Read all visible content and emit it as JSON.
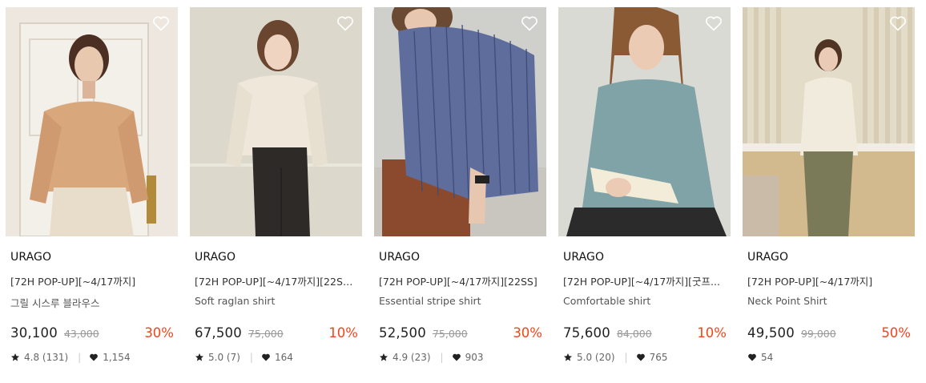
{
  "products": [
    {
      "brand": "URAGO",
      "title_line1": "[72H POP-UP][~4/17까지]",
      "title_line2": "그릴 시스루 블라우스",
      "price": "30,100",
      "original_price": "43,000",
      "discount": "30%",
      "rating": "4.8 (131)",
      "likes": "1,154",
      "image_description": "woman in sheer camel blouse and cream jeans, white door background",
      "colors": {
        "bg": "#e6dfd6",
        "top": "#d9a77c",
        "bottom": "#e8dccb",
        "hair": "#4a2f22"
      }
    },
    {
      "brand": "URAGO",
      "title_line1": "[72H POP-UP][~4/17까지][22SP...",
      "title_line2": "Soft raglan shirt",
      "price": "67,500",
      "original_price": "75,000",
      "discount": "10%",
      "rating": "5.0 (7)",
      "likes": "164",
      "image_description": "woman in ivory shirt and black trousers, beige wall",
      "colors": {
        "bg": "#dcd8cc",
        "top": "#efe8da",
        "bottom": "#2e2a28",
        "hair": "#6a4630"
      }
    },
    {
      "brand": "URAGO",
      "title_line1": "[72H POP-UP][~4/17까지][22SS]",
      "title_line2": "Essential stripe shirt",
      "price": "52,500",
      "original_price": "75,000",
      "discount": "30%",
      "rating": "4.9 (23)",
      "likes": "903",
      "image_description": "woman in blue stripe shirt leaning on wooden table",
      "colors": {
        "bg": "#cfcfcb",
        "top": "#5e6d9c",
        "bottom": "#8b4a2e",
        "hair": "#6b4a33"
      }
    },
    {
      "brand": "URAGO",
      "title_line1": "[72H POP-UP][~4/17까지][굿프...",
      "title_line2": "Comfortable shirt",
      "price": "75,600",
      "original_price": "84,000",
      "discount": "10%",
      "rating": "5.0 (20)",
      "likes": "765",
      "image_description": "woman with long hair in teal shirt reading a book",
      "colors": {
        "bg": "#dadad5",
        "top": "#7fa3a6",
        "bottom": "#2b2b2b",
        "hair": "#8a5a34"
      }
    },
    {
      "brand": "URAGO",
      "title_line1": "[72H POP-UP][~4/17까지]",
      "title_line2": "Neck Point Shirt",
      "price": "49,500",
      "original_price": "99,000",
      "discount": "50%",
      "rating": "",
      "likes": "54",
      "image_description": "woman in cream high-neck shirt and olive trousers, striped wallpaper",
      "colors": {
        "bg": "#e3dcc8",
        "top": "#f1ebdd",
        "bottom": "#7b7a58",
        "hair": "#4f3323"
      }
    }
  ],
  "accent": {
    "discount": "#f2441c",
    "text": "#222222",
    "muted": "#999999"
  },
  "icons": {
    "wishlist": "heart-outline-icon",
    "rating": "star-icon",
    "likes": "heart-filled-icon"
  }
}
